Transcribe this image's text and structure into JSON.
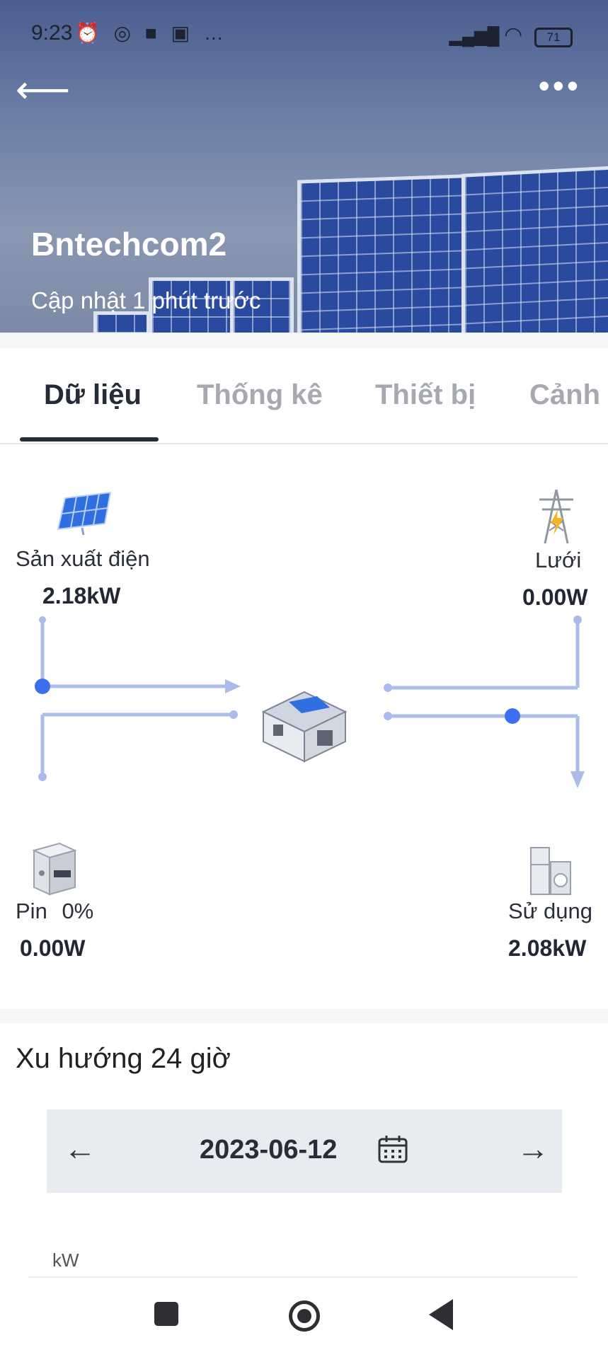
{
  "status_bar": {
    "time": "9:23",
    "icons": [
      "alarm-icon",
      "location-icon",
      "notification-icon",
      "shopee-icon",
      "more-icon"
    ],
    "battery": "71"
  },
  "header": {
    "title": "Bntechcom2",
    "subtitle": "Cập nhật 1 phút trước",
    "back_icon": "arrow-left-icon",
    "more_icon": "more-horizontal-icon"
  },
  "tabs": [
    {
      "label": "Dữ liệu",
      "active": true
    },
    {
      "label": "Thống kê",
      "active": false
    },
    {
      "label": "Thiết bị",
      "active": false
    },
    {
      "label": "Cảnh l",
      "active": false
    }
  ],
  "energy_flow": {
    "production": {
      "label": "Sản xuất điện",
      "value": "2.18kW",
      "icon": "solar-panel-icon"
    },
    "grid": {
      "label": "Lưới",
      "value": "0.00W",
      "icon": "power-tower-icon"
    },
    "battery": {
      "label": "Pin",
      "percent": "0%",
      "value": "0.00W",
      "icon": "battery-cabinet-icon"
    },
    "consumption": {
      "label": "Sử dụng",
      "value": "2.08kW",
      "icon": "appliance-icon"
    },
    "center_icon": "house-icon",
    "line_color": "#a9bde8",
    "dot_color": "#3b6ff0"
  },
  "trend": {
    "title": "Xu hướng 24 giờ",
    "date": "2023-06-12",
    "unit": "kW"
  },
  "colors": {
    "accent": "#262b38",
    "inactive_tab": "#a6a9b0"
  }
}
